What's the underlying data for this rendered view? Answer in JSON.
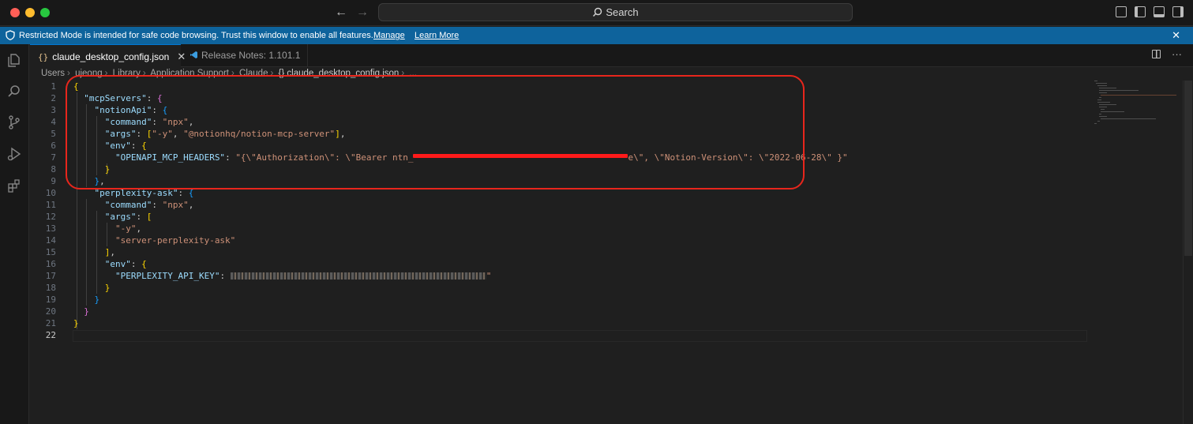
{
  "titlebar": {
    "search_label": "Search",
    "back_icon": "arrow-left-icon",
    "forward_icon": "arrow-right-icon"
  },
  "banner": {
    "message": "Restricted Mode is intended for safe code browsing. Trust this window to enable all features.",
    "manage_label": "Manage",
    "learn_more_label": "Learn More",
    "color": "#0e639c"
  },
  "tabs": [
    {
      "label": "claude_desktop_config.json",
      "icon": "{}",
      "active": true
    },
    {
      "label": "Release Notes: 1.101.1",
      "active": false
    }
  ],
  "breadcrumb": [
    "Users",
    "ujeong",
    "Library",
    "Application Support",
    "Claude",
    "{} claude_desktop_config.json",
    "..."
  ],
  "editor": {
    "line_numbers": [
      "1",
      "2",
      "3",
      "4",
      "5",
      "6",
      "7",
      "8",
      "9",
      "10",
      "11",
      "12",
      "13",
      "14",
      "15",
      "16",
      "17",
      "18",
      "19",
      "20",
      "21",
      "22"
    ],
    "current_line": "22",
    "tokens": {
      "l1_open": "{",
      "l2_key": "\"mcpServers\"",
      "l2_colon": ": ",
      "l2_open": "{",
      "l3_key": "\"notionApi\"",
      "l3_colon": ": ",
      "l3_open": "{",
      "l4_key": "\"command\"",
      "l4_colon": ": ",
      "l4_val": "\"npx\"",
      "l4_comma": ",",
      "l5_key": "\"args\"",
      "l5_colon": ": ",
      "l5_open": "[",
      "l5_val1": "\"-y\"",
      "l5_sep": ", ",
      "l5_val2": "\"@notionhq/notion-mcp-server\"",
      "l5_close": "]",
      "l5_comma": ",",
      "l6_key": "\"env\"",
      "l6_colon": ": ",
      "l6_open": "{",
      "l7_key": "\"OPENAPI_MCP_HEADERS\"",
      "l7_colon": ": ",
      "l7_val_a": "\"{\\\"Authorization\\\": \\\"Bearer ntn_",
      "l7_val_b": "e\\\", \\\"Notion-Version\\\": \\\"2022-06-28\\\" }\"",
      "l8_close": "}",
      "l9_close": "}",
      "l9_comma": ",",
      "l10_key": "\"perplexity-ask\"",
      "l10_colon": ": ",
      "l10_open": "{",
      "l11_key": "\"command\"",
      "l11_colon": ": ",
      "l11_val": "\"npx\"",
      "l11_comma": ",",
      "l12_key": "\"args\"",
      "l12_colon": ": ",
      "l12_open": "[",
      "l13_val": "\"-y\"",
      "l13_comma": ",",
      "l14_val": "\"server-perplexity-ask\"",
      "l15_close": "]",
      "l15_comma": ",",
      "l16_key": "\"env\"",
      "l16_colon": ": ",
      "l16_open": "{",
      "l17_key": "\"PERPLEXITY_API_KEY\"",
      "l17_colon": ": ",
      "l17_end": "\"",
      "l18_close": "}",
      "l19_close": "}",
      "l20_close": "}",
      "l21_close": "}"
    }
  },
  "colors": {
    "annotation_red": "#e8261c",
    "key": "#9cdcfe",
    "string": "#ce9178"
  }
}
